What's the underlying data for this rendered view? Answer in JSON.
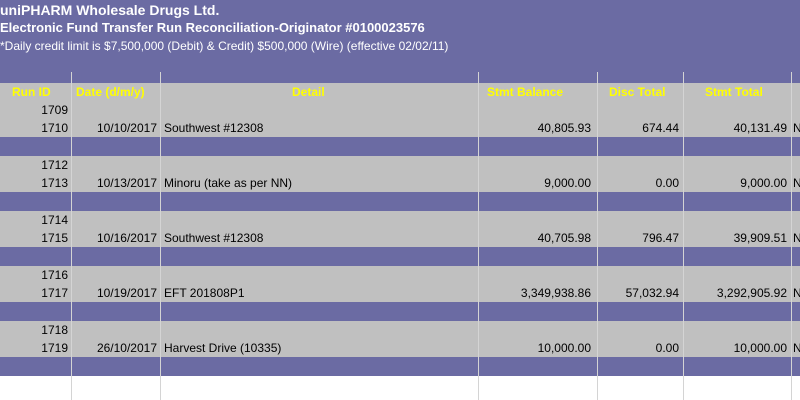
{
  "header": {
    "company": "uniPHARM Wholesale Drugs Ltd.",
    "report": "Electronic Fund Transfer Run Reconciliation-Originator #0100023576",
    "note": "*Daily credit limit is $7,500,000 (Debit) & Credit) $500,000 (Wire) (effective 02/02/11)"
  },
  "columns": {
    "run_id": "Run ID",
    "date": "Date (d/m/y)",
    "detail": "Detail",
    "stmt_balance": "Stmt Balance",
    "disc_total": "Disc Total",
    "stmt_total": "Stmt Total"
  },
  "groups": [
    {
      "first_id": "1709",
      "id": "1710",
      "date": "10/10/2017",
      "detail": "Southwest  #12308",
      "stmt_balance": "40,805.93",
      "disc_total": "674.44",
      "stmt_total": "40,131.49",
      "next": "N"
    },
    {
      "first_id": "1712",
      "id": "1713",
      "date": "10/13/2017",
      "detail": "Minoru (take as per NN)",
      "stmt_balance": "9,000.00",
      "disc_total": "0.00",
      "stmt_total": "9,000.00",
      "next": "N"
    },
    {
      "first_id": "1714",
      "id": "1715",
      "date": "10/16/2017",
      "detail": "Southwest #12308",
      "stmt_balance": "40,705.98",
      "disc_total": "796.47",
      "stmt_total": "39,909.51",
      "next": "N"
    },
    {
      "first_id": "1716",
      "id": "1717",
      "date": "10/19/2017",
      "detail": "EFT 201808P1",
      "stmt_balance": "3,349,938.86",
      "disc_total": "57,032.94",
      "stmt_total": "3,292,905.92",
      "next": "N"
    },
    {
      "first_id": "1718",
      "id": "1719",
      "date": "26/10/2017",
      "detail": "Harvest Drive (10335)",
      "stmt_balance": "10,000.00",
      "disc_total": "0.00",
      "stmt_total": "10,000.00",
      "next": "N"
    }
  ],
  "colors": {
    "band": "#6b6ba3",
    "grey": "#c0c0c0",
    "header_text": "#ffff00"
  }
}
